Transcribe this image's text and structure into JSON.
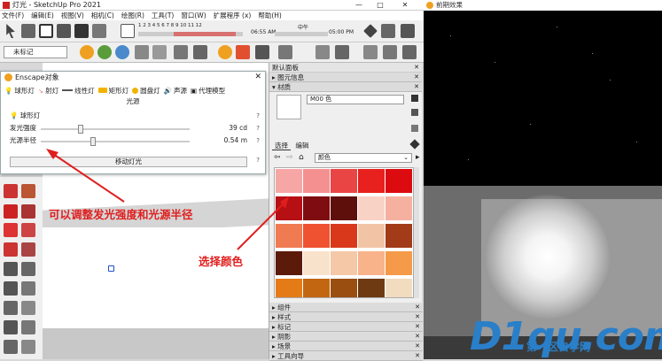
{
  "window": {
    "title": "灯光 - SketchUp Pro 2021",
    "min": "—",
    "max": "□",
    "close": "✕"
  },
  "menu": [
    "文件(F)",
    "编辑(E)",
    "视图(V)",
    "相机(C)",
    "绘图(R)",
    "工具(T)",
    "窗口(W)",
    "扩展程序 (x)",
    "帮助(H)"
  ],
  "timebar": {
    "months": "1 2 3 4 5 6 7 8 9 10 11 12",
    "start_time": "06:55 AM",
    "mid_label": "中午",
    "end_time": "05:00 PM"
  },
  "tag_select": "未标记",
  "enscape_dialog": {
    "title": "Enscape对象",
    "tabs": [
      "球形灯",
      "射灯",
      "线性灯",
      "矩形灯",
      "圆盘灯",
      "声源",
      "代理模型"
    ],
    "section_label": "光源",
    "light_type": "球形灯",
    "rows": [
      {
        "label": "发光强度",
        "value": "39 cd",
        "knob_pct": 0.27
      },
      {
        "label": "光源半径",
        "value": "0.54 m",
        "knob_pct": 0.35
      }
    ],
    "move_button": "移动灯光",
    "help": "?"
  },
  "default_panel": {
    "title": "默认面板",
    "entity_info": "图元信息",
    "materials": "材质",
    "material_name": "M00 色",
    "select_tab": "选择",
    "edit_tab": "编辑",
    "color_set": "颜色",
    "collapsed_sections": [
      "组件",
      "样式",
      "标记",
      "阴影",
      "场景",
      "工具向导"
    ]
  },
  "swatch_colors": [
    [
      "#f7a6a6",
      "#f59090",
      "#e94545",
      "#e8201e",
      "#dc0b10"
    ],
    [
      "#b60f14",
      "#7e0c10",
      "#5e0f0c",
      "#f9d2c6",
      "#f5b0a0"
    ],
    [
      "#f07b52",
      "#ef5230",
      "#d9391a",
      "#f2c4a6",
      "#a23b18"
    ],
    [
      "#5c1a0a",
      "#f9e2cc",
      "#f5c8a8",
      "#f9b38a",
      "#f49a48"
    ],
    [
      "#e57b16",
      "#c36612",
      "#9a4e10",
      "#6e3a12",
      "#f2dcc0"
    ]
  ],
  "render_window": {
    "title": "前期效果"
  },
  "annotations": {
    "left": "可以调整发光强度和光源半径",
    "right": "选择颜色"
  },
  "watermark": {
    "big": "D1qu.com",
    "small": "第一区自学网"
  },
  "annotation_color": "#e01e1e"
}
